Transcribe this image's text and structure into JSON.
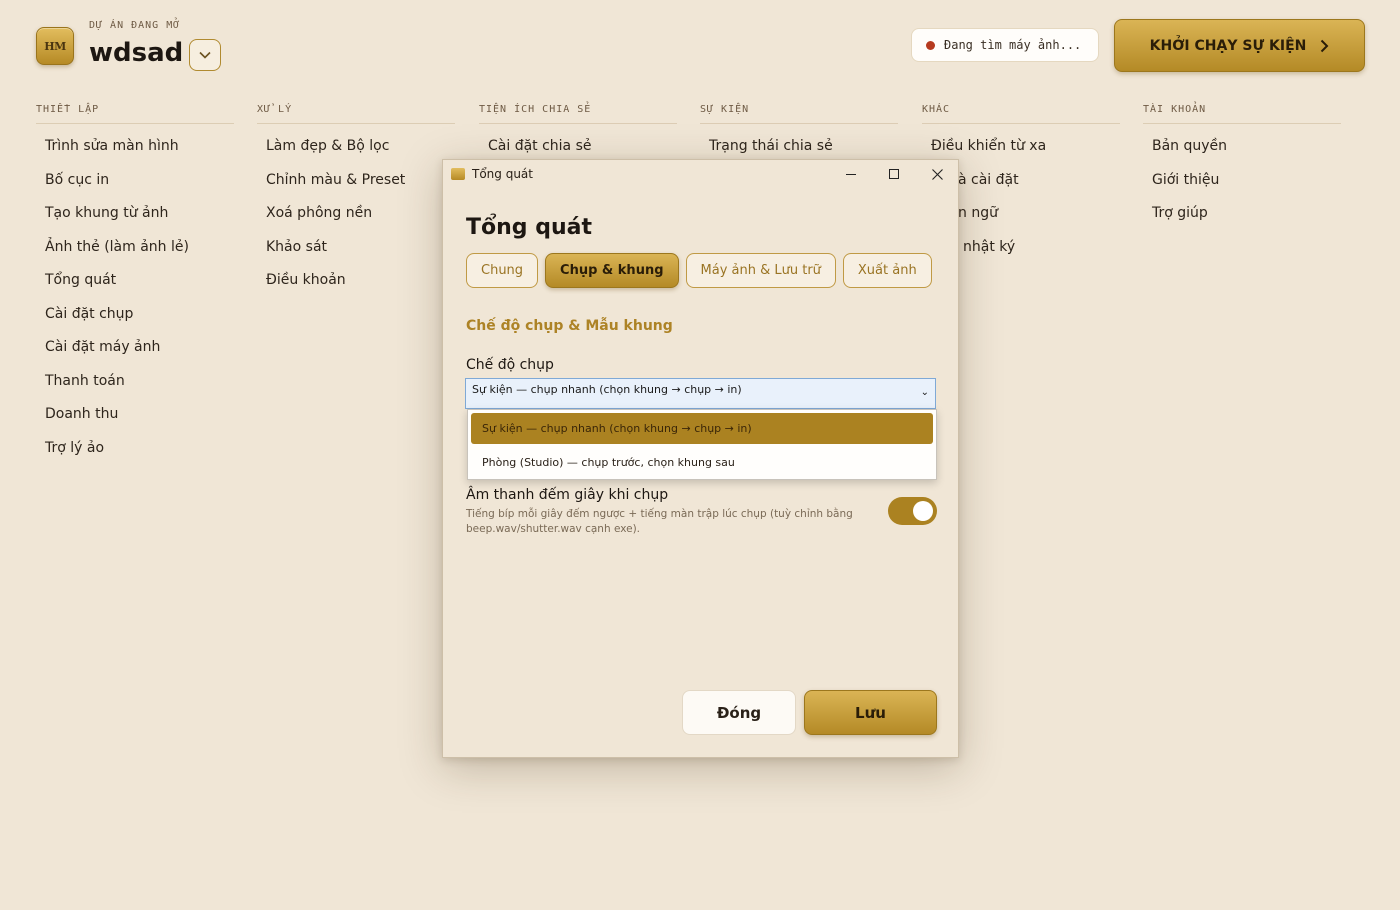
{
  "header": {
    "logo_text": "HM",
    "project_label": "DỰ ÁN ĐANG MỞ",
    "project_name": "wdsad",
    "status_text": "Đang tìm máy ảnh...",
    "launch_label": "KHỞI CHẠY SỰ KIỆN"
  },
  "columns": [
    {
      "title": "THIẾT LẬP",
      "items": [
        "Trình sửa màn hình",
        "Bố cục in",
        "Tạo khung từ ảnh",
        "Ảnh thẻ (làm ảnh lẻ)",
        "Tổng quát",
        "Cài đặt chụp",
        "Cài đặt máy ảnh",
        "Thanh toán",
        "Doanh thu",
        "Trợ lý ảo"
      ]
    },
    {
      "title": "XỬ LÝ",
      "items": [
        "Làm đẹp & Bộ lọc",
        "Chỉnh màu & Preset",
        "Xoá phông nền",
        "Khảo sát",
        "Điều khoản"
      ]
    },
    {
      "title": "TIỆN ÍCH CHIA SẺ",
      "items": [
        "Cài đặt chia sẻ"
      ]
    },
    {
      "title": "SỰ KIỆN",
      "items": [
        "Trạng thái chia sẻ"
      ]
    },
    {
      "title": "KHÁC",
      "items": [
        "Điều khiển từ xa",
        "à cài đặt",
        "n ngữ",
        "nhật ký"
      ]
    },
    {
      "title": "TÀI KHOẢN",
      "items": [
        "Bản quyền",
        "Giới thiệu",
        "Trợ giúp"
      ]
    }
  ],
  "dialog": {
    "window_title": "Tổng quát",
    "heading": "Tổng quát",
    "tabs": [
      "Chung",
      "Chụp & khung",
      "Máy ảnh & Lưu trữ",
      "Xuất ảnh"
    ],
    "section_title": "Chế độ chụp & Mẫu khung",
    "capture_mode_label": "Chế độ chụp",
    "capture_mode_value": "Sự kiện — chụp nhanh (chọn khung → chụp → in)",
    "capture_mode_options": [
      "Sự kiện — chụp nhanh (chọn khung → chụp → in)",
      "Phòng (Studio) — chụp trước, chọn khung sau"
    ],
    "sound_title": "Âm thanh đếm giây khi chụp",
    "sound_desc": "Tiếng bíp mỗi giây đếm ngược + tiếng màn trập lúc chụp (tuỳ chỉnh bằng beep.wav/shutter.wav cạnh exe).",
    "sound_enabled": true,
    "close_label": "Đóng",
    "save_label": "Lưu"
  },
  "colors": {
    "background": "#f0e6d6",
    "accent": "#ab8221",
    "accent_light": "#dab455",
    "status_dot": "#b63a1f"
  }
}
